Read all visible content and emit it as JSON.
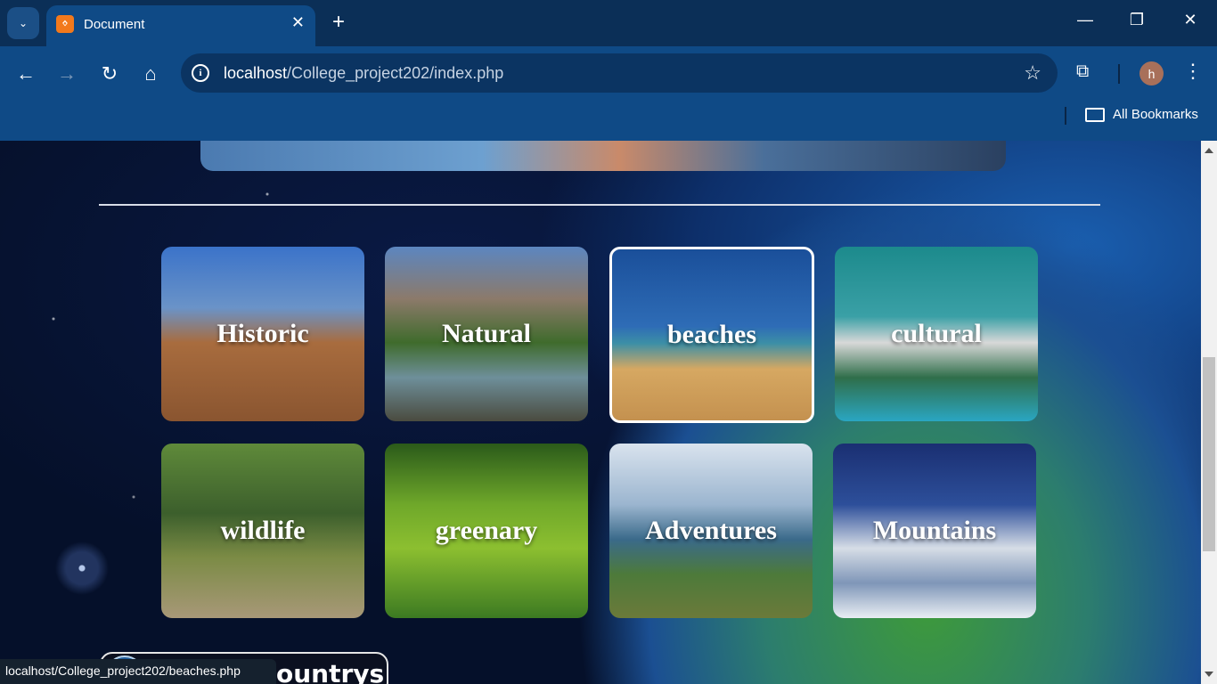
{
  "browser": {
    "tab_title": "Document",
    "tab_favicon": "xampp-icon",
    "url_host": "localhost",
    "url_path": "/College_project202/index.php",
    "bookmarks_label": "All Bookmarks",
    "avatar_letter": "h"
  },
  "page": {
    "categories": [
      {
        "label": "Historic"
      },
      {
        "label": "Natural"
      },
      {
        "label": "beaches"
      },
      {
        "label": "cultural"
      },
      {
        "label": "wildlife"
      },
      {
        "label": "greenary"
      },
      {
        "label": "Adventures"
      },
      {
        "label": "Mountains"
      }
    ],
    "countries_label": "ountrys"
  },
  "status_bar": {
    "hover_url": "localhost/College_project202/beaches.php"
  }
}
